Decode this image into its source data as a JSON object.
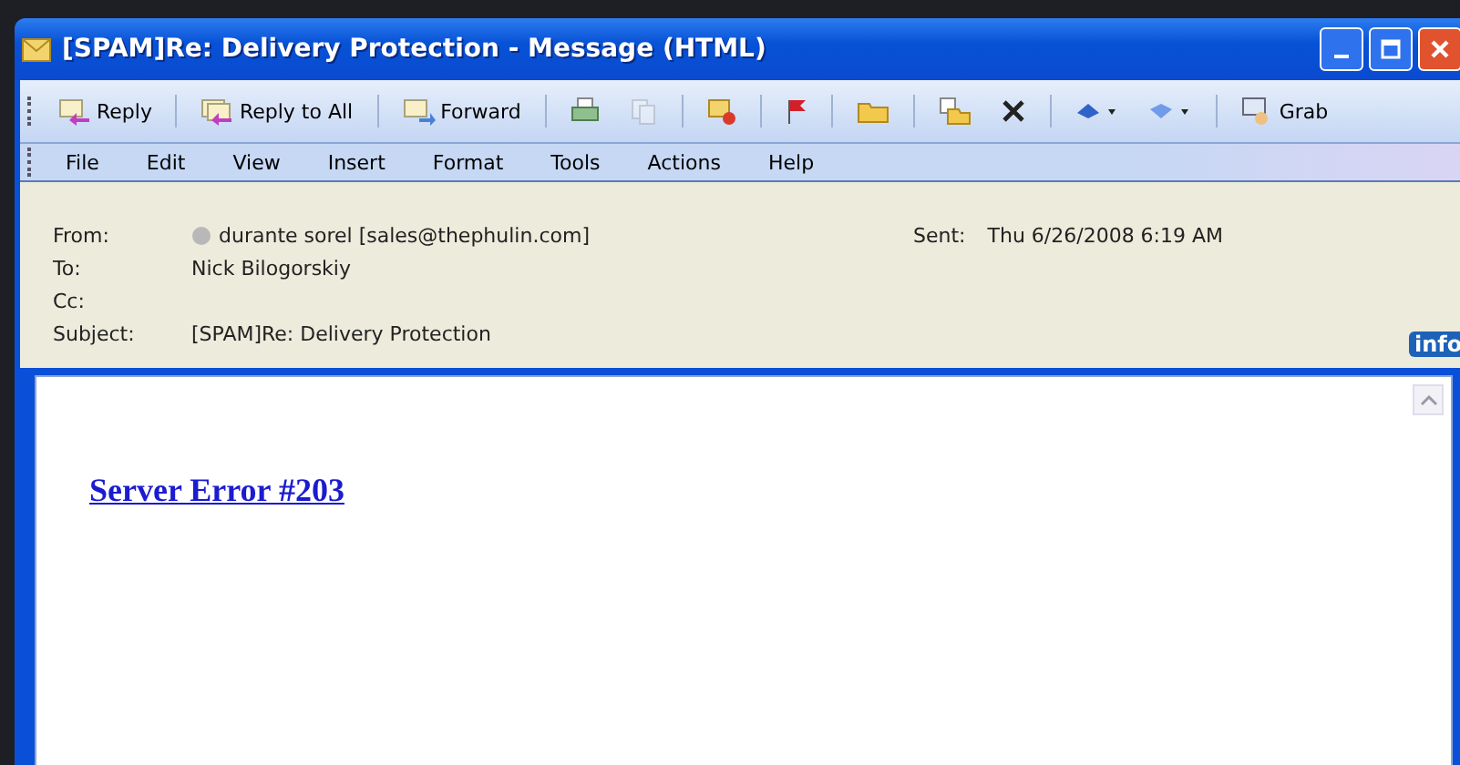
{
  "window": {
    "title": "[SPAM]Re: Delivery Protection - Message (HTML)"
  },
  "toolbar": {
    "items": [
      {
        "kind": "reply",
        "label": "Reply",
        "disabled": false
      },
      {
        "kind": "separator"
      },
      {
        "kind": "replyall",
        "label": "Reply to All",
        "disabled": false
      },
      {
        "kind": "separator"
      },
      {
        "kind": "forward",
        "label": "Forward",
        "disabled": false
      },
      {
        "kind": "separator"
      },
      {
        "kind": "print",
        "disabled": false
      },
      {
        "kind": "copy",
        "disabled": true
      },
      {
        "kind": "separator"
      },
      {
        "kind": "categorize",
        "disabled": false
      },
      {
        "kind": "separator"
      },
      {
        "kind": "flag",
        "disabled": false
      },
      {
        "kind": "separator"
      },
      {
        "kind": "folder",
        "disabled": false
      },
      {
        "kind": "separator"
      },
      {
        "kind": "move",
        "disabled": false
      },
      {
        "kind": "delete",
        "disabled": false
      },
      {
        "kind": "separator"
      },
      {
        "kind": "up",
        "disabled": false
      },
      {
        "kind": "down",
        "disabled": false
      },
      {
        "kind": "separator"
      },
      {
        "kind": "grab",
        "label": "Grab",
        "disabled": false
      }
    ]
  },
  "menu": [
    "File",
    "Edit",
    "View",
    "Insert",
    "Format",
    "Tools",
    "Actions",
    "Help"
  ],
  "header": {
    "fields": [
      {
        "kind": "sender",
        "label": "From:",
        "value": "durante sorel [sales@thephulin.com]"
      },
      {
        "kind": "plain",
        "label": "To:",
        "value": "Nick Bilogorskiy"
      },
      {
        "kind": "plain",
        "label": "Cc:"
      },
      {
        "kind": "plain",
        "label": "Subject:",
        "value": "[SPAM]Re: Delivery Protection"
      }
    ],
    "sent": {
      "label": "Sent:",
      "value": "Thu 6/26/2008 6:19 AM"
    },
    "badge": "info"
  },
  "body": {
    "link": "Server Error #203"
  }
}
